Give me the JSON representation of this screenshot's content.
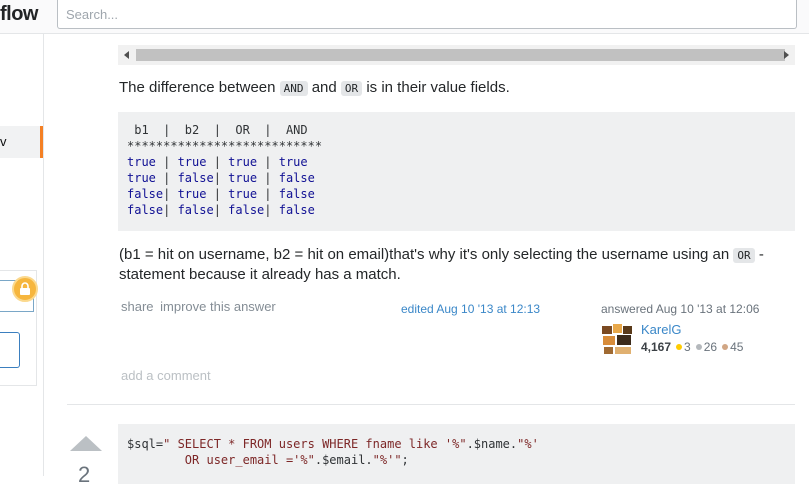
{
  "header": {
    "logo_text": "flow",
    "search_placeholder": "Search..."
  },
  "sidebar": {
    "active_item_label": "v"
  },
  "answer": {
    "intro_pre": "The difference between ",
    "intro_and": "AND",
    "intro_mid": " and ",
    "intro_or": "OR",
    "intro_post": " is in their value fields.",
    "table_header": " b1  |  b2  |  OR  |  AND",
    "table_rule": "***************************",
    "table_rows": [
      [
        "true ",
        "| ",
        "true ",
        "| ",
        "true ",
        "| ",
        "true"
      ],
      [
        "true ",
        "| ",
        "false",
        "| ",
        "true ",
        "| ",
        "false"
      ],
      [
        "false",
        "| ",
        "true ",
        "| ",
        "true ",
        "| ",
        "false"
      ],
      [
        "false",
        "| ",
        "false",
        "| ",
        "false",
        "| ",
        "false"
      ]
    ],
    "explain_pre": "(b1 = hit on username, b2 = hit on email)that's why it's only selecting the username using an ",
    "explain_code": "OR",
    "explain_post": " - statement because it already has a match.",
    "share_label": "share",
    "improve_label": "improve this answer",
    "edited_label": "edited Aug 10 '13 at 12:13",
    "answered_label": "answered Aug 10 '13 at 12:06",
    "user_name": "KarelG",
    "reputation": "4,167",
    "badges": {
      "gold": "3",
      "silver": "26",
      "bronze": "45",
      "gold_color": "#ffcc01",
      "silver_color": "#b4b8bc",
      "bronze_color": "#d1a684"
    },
    "add_comment_label": "add a comment"
  },
  "next_answer": {
    "vote_count": "2",
    "code_line1_a": "$sql=",
    "code_line1_b": "\" SELECT * FROM users WHERE fname like '%\"",
    "code_line1_c": ".$name.",
    "code_line1_d": "\"%'",
    "code_line2_a": "        OR user_email ='%\"",
    "code_line2_b": ".$email.",
    "code_line2_c": "\"%'\"",
    "code_line2_d": ";"
  }
}
